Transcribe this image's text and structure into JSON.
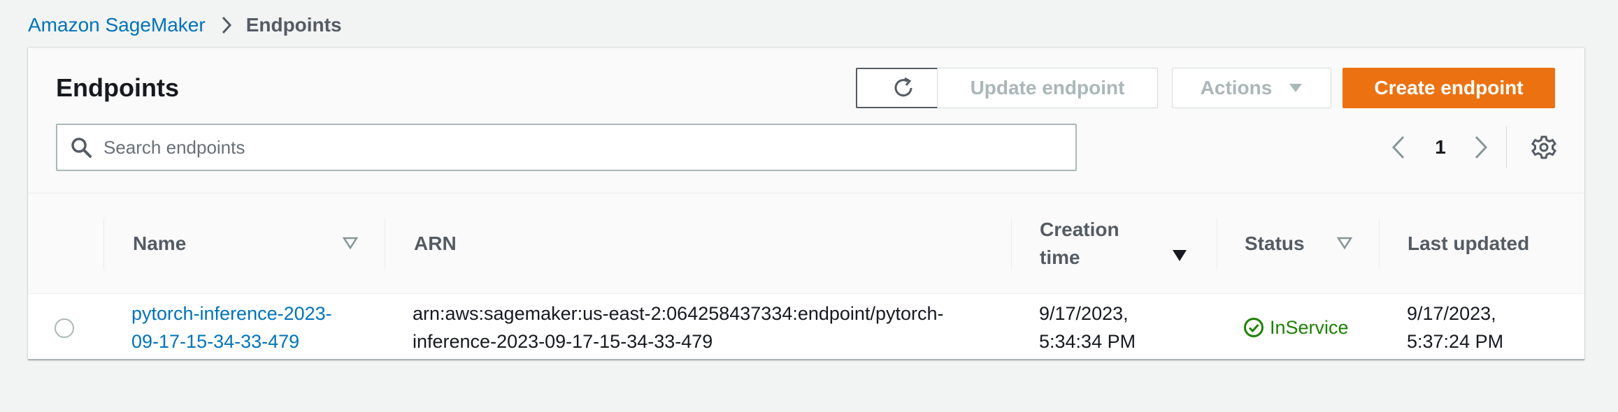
{
  "breadcrumb": {
    "parent": "Amazon SageMaker",
    "current": "Endpoints"
  },
  "panel": {
    "title": "Endpoints",
    "buttons": {
      "update": "Update endpoint",
      "actions": "Actions",
      "create": "Create endpoint"
    },
    "search": {
      "placeholder": "Search endpoints",
      "value": ""
    },
    "pagination": {
      "current_page": "1"
    }
  },
  "table": {
    "columns": {
      "name": "Name",
      "arn": "ARN",
      "creation_time": "Creation time",
      "status": "Status",
      "last_updated": "Last updated"
    },
    "rows": [
      {
        "name_line1": "pytorch-inference-2023-",
        "name_line2": "09-17-15-34-33-479",
        "arn_line1": "arn:aws:sagemaker:us-east-2:064258437334:endpoint/pytorch-",
        "arn_line2": "inference-2023-09-17-15-34-33-479",
        "creation_line1": "9/17/2023,",
        "creation_line2": "5:34:34 PM",
        "status": "InService",
        "updated_line1": "9/17/2023,",
        "updated_line2": "5:37:24 PM"
      }
    ]
  },
  "colors": {
    "link": "#0073bb",
    "primary": "#ec7211",
    "success": "#1d8102",
    "disabled": "#aab7b8",
    "background": "#f2f3f3"
  },
  "icons": [
    "chevron-right-icon",
    "refresh-icon",
    "caret-down-icon",
    "search-icon",
    "chevron-left-icon",
    "gear-icon",
    "sort-icon",
    "check-circle-icon"
  ]
}
